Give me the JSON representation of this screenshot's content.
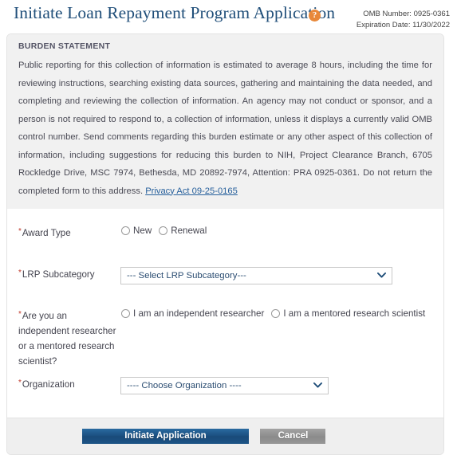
{
  "header": {
    "title": "Initiate Loan Repayment Program Application",
    "help_icon": "help-circle-icon",
    "help_glyph": "?",
    "omb_number": "OMB Number: 0925-0361",
    "expiration_date": "Expiration Date: 11/30/2022",
    "title_color": "#1f4e79",
    "help_icon_color": "#e8883a"
  },
  "burden": {
    "heading": "BURDEN STATEMENT",
    "body": "Public reporting for this collection of information is estimated to average 8 hours, including the time for reviewing instructions, searching existing data sources, gathering and maintaining the data needed, and completing and reviewing the collection of information. An agency may not conduct or sponsor, and a person is not required to respond to, a collection of information, unless it displays a currently valid OMB control number. Send comments regarding this burden estimate or any other aspect of this collection of information, including suggestions for reducing this burden to NIH, Project Clearance Branch, 6705 Rockledge Drive, MSC 7974, Bethesda, MD 20892-7974, Attention: PRA 0925-0361. Do not return the completed form to this address. ",
    "privacy_link": "Privacy Act 09-25-0165",
    "link_color": "#27609c"
  },
  "form": {
    "required_marker": "*",
    "award_type": {
      "label": "Award Type",
      "options": [
        {
          "label": "New",
          "selected": false
        },
        {
          "label": "Renewal",
          "selected": false
        }
      ]
    },
    "lrp_subcategory": {
      "label": "LRP Subcategory",
      "selected": "--- Select LRP Subcategory---"
    },
    "researcher_status": {
      "label": "Are you an independent researcher or a mentored research scientist?",
      "options": [
        {
          "label": "I am an independent researcher",
          "selected": false
        },
        {
          "label": "I am a mentored research scientist",
          "selected": false
        }
      ]
    },
    "organization": {
      "label": "Organization",
      "selected": "---- Choose Organization ----"
    }
  },
  "footer": {
    "submit_label": "Initiate Application",
    "cancel_label": "Cancel",
    "submit_color": "#1b4f80",
    "cancel_color": "#8e8e8e"
  }
}
